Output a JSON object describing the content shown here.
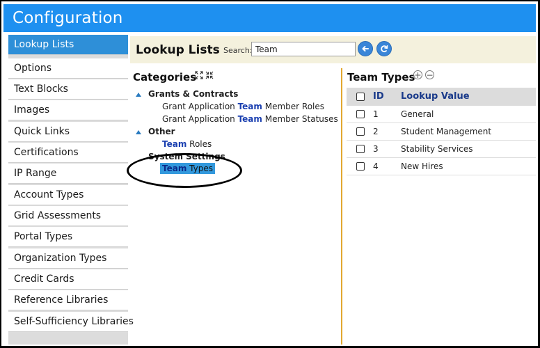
{
  "window": {
    "title": "Configuration"
  },
  "sidebar": {
    "items": [
      {
        "label": "Lookup Lists",
        "active": true
      },
      {
        "label": "Options"
      },
      {
        "label": "Text Blocks"
      },
      {
        "label": "Images"
      },
      {
        "label": "Quick Links"
      },
      {
        "label": "Certifications"
      },
      {
        "label": "IP Range"
      },
      {
        "label": "Account Types"
      },
      {
        "label": "Grid Assessments"
      },
      {
        "label": "Portal Types"
      },
      {
        "label": "Organization Types"
      },
      {
        "label": "Credit Cards"
      },
      {
        "label": "Reference Libraries"
      },
      {
        "label": "Self-Sufficiency Libraries"
      }
    ]
  },
  "header": {
    "title": "Lookup Lists",
    "search_label": "Search:",
    "search_value": "Team",
    "back_icon": "back-arrow-icon",
    "refresh_icon": "refresh-icon",
    "accent": "#1e90f0"
  },
  "categories": {
    "title": "Categories",
    "groups": [
      {
        "label": "Grants & Contracts",
        "leaves": [
          {
            "match": "Team",
            "before": "Grant Application ",
            "after": " Member Roles"
          },
          {
            "match": "Team",
            "before": "Grant Application ",
            "after": " Member Statuses"
          }
        ]
      },
      {
        "label": "Other",
        "leaves": [
          {
            "match": "Team",
            "before": "",
            "after": " Roles"
          }
        ]
      },
      {
        "label": "System Settings",
        "leaves": [
          {
            "match": "Team",
            "before": "",
            "after": " Types",
            "selected": true
          }
        ]
      }
    ]
  },
  "types": {
    "title": "Team Types",
    "columns": {
      "id": "ID",
      "value": "Lookup Value"
    },
    "rows": [
      {
        "id": "1",
        "value": "General"
      },
      {
        "id": "2",
        "value": "Student Management"
      },
      {
        "id": "3",
        "value": "Stability Services"
      },
      {
        "id": "4",
        "value": "New Hires"
      }
    ]
  }
}
